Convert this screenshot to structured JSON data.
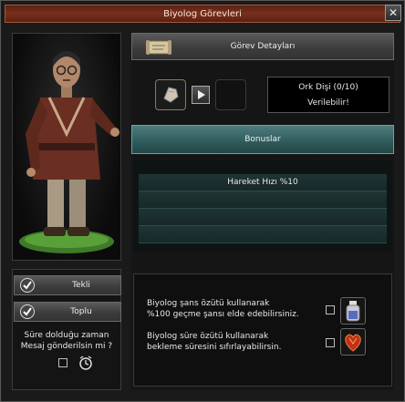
{
  "window": {
    "title": "Biyolog Görevleri",
    "close_glyph": "✕"
  },
  "left": {
    "buttons": [
      {
        "label": "Tekli",
        "icon": "check-circle-icon"
      },
      {
        "label": "Toplu",
        "icon": "check-circle-icon"
      }
    ],
    "notify_question_line1": "Süre dolduğu zaman",
    "notify_question_line2": "Mesaj gönderilsin mi ?",
    "alarm_icon": "alarm-clock-icon"
  },
  "detail": {
    "header_label": "Görev Detayları",
    "item_name": "Ork Dişi (0/10)",
    "status": "Verilebilir!"
  },
  "bonus": {
    "header_label": "Bonuslar",
    "rows": [
      "Hareket Hızı %10",
      "",
      "",
      ""
    ]
  },
  "bottom": {
    "chance_line1": "Biyolog şans özütü kullanarak",
    "chance_line2": "%100 geçme şansı elde edebilirsiniz.",
    "time_line1": "Biyolog süre özütü kullanarak",
    "time_line2": "bekleme süresini sıfırlayabilirsin."
  },
  "colors": {
    "title_bar": "#7a2f1c",
    "bonus_header": "#2e5a5a"
  }
}
